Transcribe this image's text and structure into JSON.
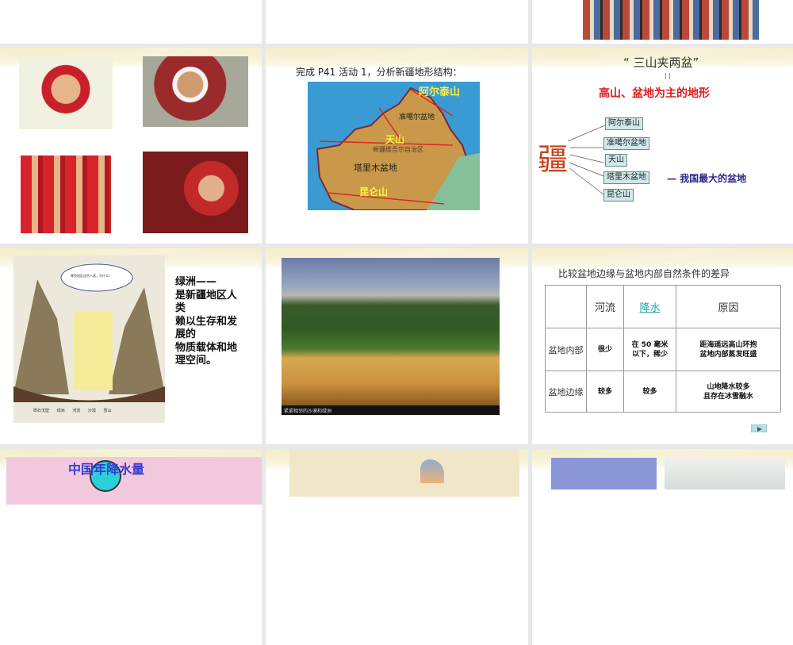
{
  "slides": {
    "map_slide": {
      "instruction": "完成 P41 活动 1，分析新疆地形结构：",
      "labels": {
        "altai": "阿尔泰山",
        "junggar": "准噶尔盆地",
        "tianshan": "天山",
        "xinjiang": "新疆维吾尔自治区",
        "tarim": "塔里木盆地",
        "kunlun": "昆仑山"
      }
    },
    "structure_slide": {
      "title": "“ 三山夹两盆”",
      "equals": "| |",
      "subtitle": "高山、盆地为主的地形",
      "big_char": "疆",
      "items": [
        "阿尔泰山",
        "准噶尔盆地",
        "天山",
        "塔里木盆地",
        "昆仑山"
      ],
      "note": "—  我国最大的盆地"
    },
    "oasis_slide": {
      "lines": [
        "绿洲——",
        "是新疆地区人",
        "类",
        "赖以生存和发",
        "展的",
        "物质载体和地",
        "理空间。"
      ],
      "bubble": "哪些地区适合人居，为什么？",
      "diagram_labels": [
        "砾石戈壁",
        "绿洲",
        "河流",
        "沙漠",
        "雪山"
      ]
    },
    "photo_slide": {
      "caption": "紧紧相邻的沙漠和绿洲"
    },
    "table_slide": {
      "title": "比较盆地边缘与盆地内部自然条件的差异",
      "headers": [
        "",
        "河流",
        "降水",
        "原因"
      ],
      "rows": [
        [
          "盆地内部",
          "很少",
          "在 50 毫米\n以下，稀少",
          "距海遥远高山环抱\n盆地内部蒸发旺盛"
        ],
        [
          "盆地边缘",
          "较多",
          "较多",
          "山地降水较多\n且存在冰雪融水"
        ]
      ],
      "next_icon": "play-icon"
    },
    "rain_slide": {
      "title": "中国年降水量"
    }
  },
  "colors": {
    "red": "#e0191e",
    "navy": "#2a2a8a",
    "link": "#2a9aa8",
    "char": "#c8401c"
  }
}
